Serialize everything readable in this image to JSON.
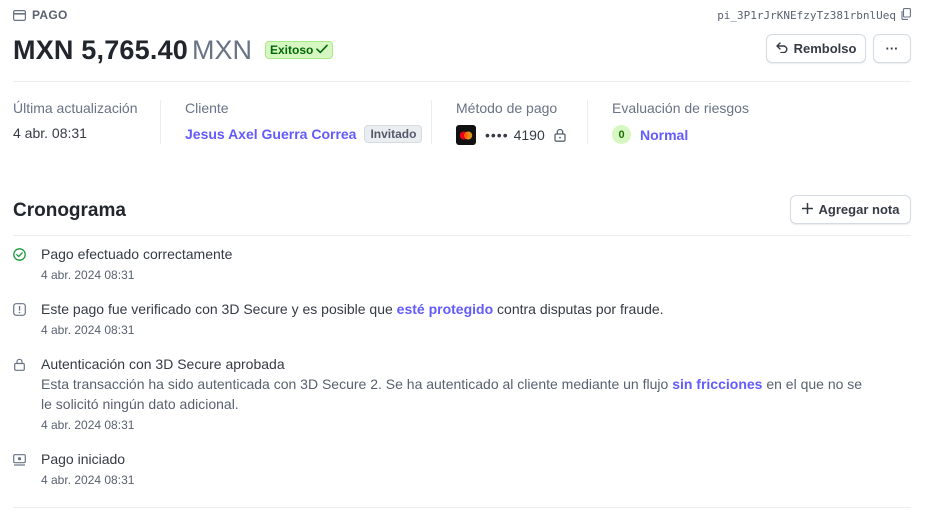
{
  "header": {
    "page_label": "PAGO",
    "payment_id": "pi_3P1rJrKNEfzyTz381rbnlUeq",
    "amount": "MXN 5,765.40",
    "currency": "MXN",
    "status": "Exitoso",
    "refund_label": "Rembolso",
    "more_label": "···"
  },
  "summary": {
    "last_update": {
      "label": "Última actualización",
      "value": "4 abr. 08:31"
    },
    "customer": {
      "label": "Cliente",
      "name": "Jesus Axel Guerra Correa",
      "tag": "Invitado"
    },
    "payment_method": {
      "label": "Método de pago",
      "masked": "••••",
      "last4": "4190"
    },
    "risk": {
      "label": "Evaluación de riesgos",
      "score": "0",
      "level": "Normal"
    }
  },
  "timeline": {
    "title": "Cronograma",
    "add_note_label": "Agregar nota",
    "events": [
      {
        "icon": "check-circle-icon",
        "title": "Pago efectuado correctamente",
        "time": "4 abr. 2024 08:31"
      },
      {
        "icon": "info-icon",
        "title_before": "Este pago fue verificado con 3D Secure y es posible que ",
        "title_link": "esté protegido",
        "title_after": " contra disputas por fraude.",
        "time": "4 abr. 2024 08:31"
      },
      {
        "icon": "lock-icon",
        "title": "Autenticación con 3D Secure aprobada",
        "desc_before": "Esta transacción ha sido autenticada con 3D Secure 2. Se ha autenticado al cliente mediante un flujo ",
        "desc_link": "sin fricciones",
        "desc_after": " en el que no se le solicitó ningún dato adicional.",
        "time": "4 abr. 2024 08:31"
      },
      {
        "icon": "payment-started-icon",
        "title": "Pago iniciado",
        "time": "4 abr. 2024 08:31"
      }
    ]
  },
  "colors": {
    "accent": "#635bff",
    "success_bg": "#d7f7c2",
    "success_text": "#006908",
    "mastercard_red": "#eb001b",
    "mastercard_yellow": "#f79e1b"
  }
}
